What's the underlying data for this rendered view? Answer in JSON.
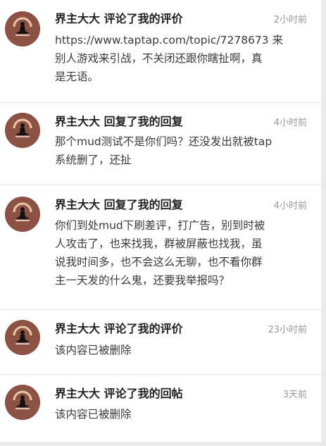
{
  "notifications": [
    {
      "title": "界主大大 评论了我的评价",
      "time": "2小时前",
      "lines": [
        "https://www.taptap.com/topic/7278673 来",
        "别人游戏来引战，不关闭还跟你瞎扯啊，真",
        "是无语。"
      ]
    },
    {
      "title": "界主大大 回复了我的回复",
      "time": "4小时前",
      "lines": [
        "那个mud测试不是你们吗？还没发出就被tap",
        "系统删了，还扯"
      ]
    },
    {
      "title": "界主大大 回复了我的回复",
      "time": "4小时前",
      "lines": [
        "你们到处mud下刷差评，打广告，别到时被",
        "人攻击了，也来找我，群被屏蔽也找我，虽",
        "说我时间多，也不会这么无聊，也不看你群",
        "主一天发的什么鬼，还要我举报吗？"
      ]
    },
    {
      "title": "界主大大 评论了我的评价",
      "time": "23小时前",
      "lines": [
        "该内容已被删除"
      ]
    },
    {
      "title": "界主大大 评论了我的回帖",
      "time": "3天前",
      "lines": [
        "该内容已被删除"
      ]
    }
  ],
  "icons": {
    "avatar": "meditating-figure-icon"
  },
  "colors": {
    "avatar_bg": "#8e5245",
    "title": "#222222",
    "time": "#9a9a9a",
    "body": "#3a3a3a"
  }
}
